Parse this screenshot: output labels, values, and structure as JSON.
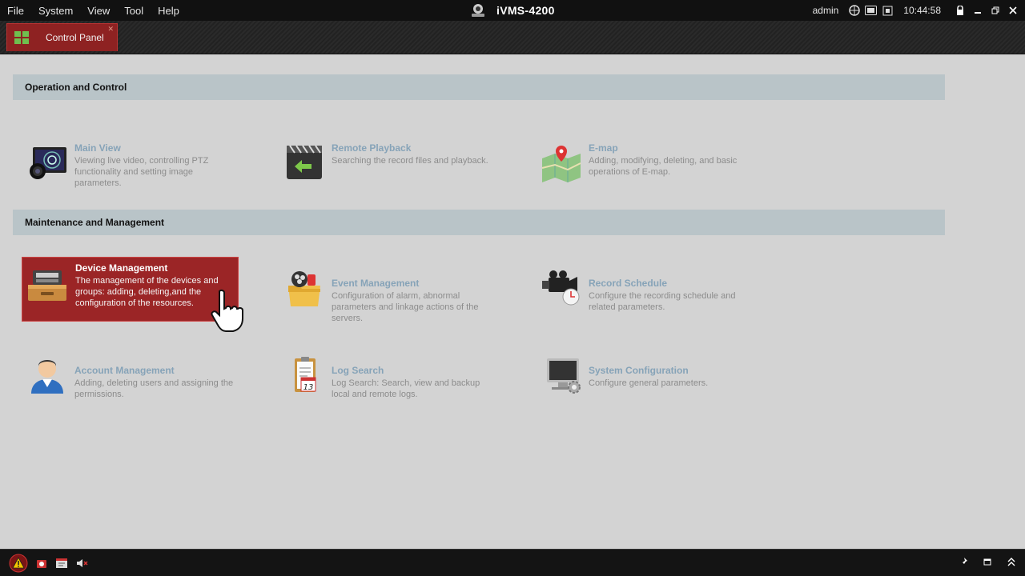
{
  "menu": [
    "File",
    "System",
    "View",
    "Tool",
    "Help"
  ],
  "app_title": "iVMS-4200",
  "tray": {
    "user": "admin",
    "time": "10:44:58",
    "icons": [
      "network-icon",
      "hdd-icon",
      "cpu-icon",
      "lock-icon",
      "minimize-icon",
      "restore-icon",
      "close-icon"
    ]
  },
  "tab": {
    "label": "Control Panel"
  },
  "sections": [
    {
      "title": "Operation and Control",
      "items": [
        {
          "title": "Main View",
          "desc": "Viewing live video, controlling PTZ functionality and setting image parameters.",
          "icon": "main-view-icon"
        },
        {
          "title": "Remote Playback",
          "desc": "Searching the record files and playback.",
          "icon": "remote-playback-icon"
        },
        {
          "title": "E-map",
          "desc": "Adding, modifying, deleting, and basic operations of E-map.",
          "icon": "emap-icon"
        }
      ]
    },
    {
      "title": "Maintenance and Management",
      "items": [
        {
          "title": "Device Management",
          "desc": "The management of the devices and groups: adding, deleting,and the configuration of the resources.",
          "icon": "device-management-icon",
          "active": true
        },
        {
          "title": "Event Management",
          "desc": "Configuration of alarm, abnormal parameters and linkage actions of the servers.",
          "icon": "event-management-icon"
        },
        {
          "title": "Record Schedule",
          "desc": "Configure the recording schedule and related parameters.",
          "icon": "record-schedule-icon"
        },
        {
          "title": "Account Management",
          "desc": "Adding, deleting users and assigning the permissions.",
          "icon": "account-management-icon"
        },
        {
          "title": "Log Search",
          "desc": "Log Search: Search, view and backup local and remote logs.",
          "icon": "log-search-icon"
        },
        {
          "title": "System Configuration",
          "desc": "Configure general parameters.",
          "icon": "system-configuration-icon"
        }
      ]
    }
  ],
  "colors": {
    "active_item": "#9b2526",
    "section_header": "#b9c4c8",
    "item_title": "#86a3b8",
    "tab": "#8e2222"
  },
  "bottom_bar": {
    "left_icons": [
      "alarm-warning-icon",
      "alarm-event-icon",
      "alarm-log-icon",
      "mute-icon"
    ],
    "right_icons": [
      "pin-icon",
      "window-icon",
      "collapse-icon"
    ]
  }
}
